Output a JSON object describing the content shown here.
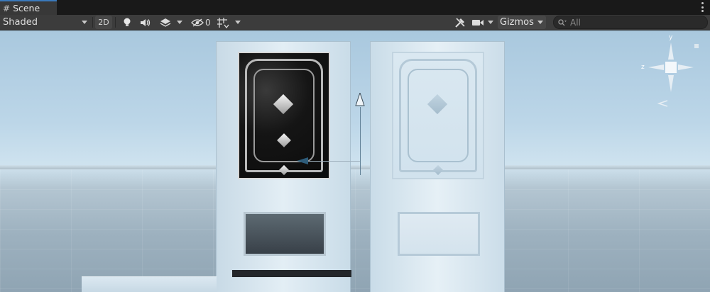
{
  "window": {
    "tab_title": "Scene"
  },
  "toolbar": {
    "shading_mode": "Shaded",
    "mode_2d": "2D",
    "hidden_count": "0",
    "gizmos_label": "Gizmos",
    "search_placeholder": "All"
  },
  "gizmo": {
    "y_label": "y",
    "z_label": "z"
  },
  "colors": {
    "tab_accent": "#3a79bb",
    "toolbar_bg": "#3c3c3c",
    "sky_top": "#a9c8de",
    "ground": "#8fa4b3",
    "gizmo_y": "#9fe04f",
    "gizmo_z": "#3d8cff"
  },
  "icons": {
    "scene_tab": "hash-icon",
    "lighting": "lightbulb-icon",
    "audio": "speaker-icon",
    "effects": "layers-icon",
    "visibility": "eye-slash-icon",
    "grid": "grid-snap-icon",
    "tools": "tools-icon",
    "camera": "camera-icon",
    "search": "search-icon",
    "menu": "kebab-menu-icon"
  }
}
